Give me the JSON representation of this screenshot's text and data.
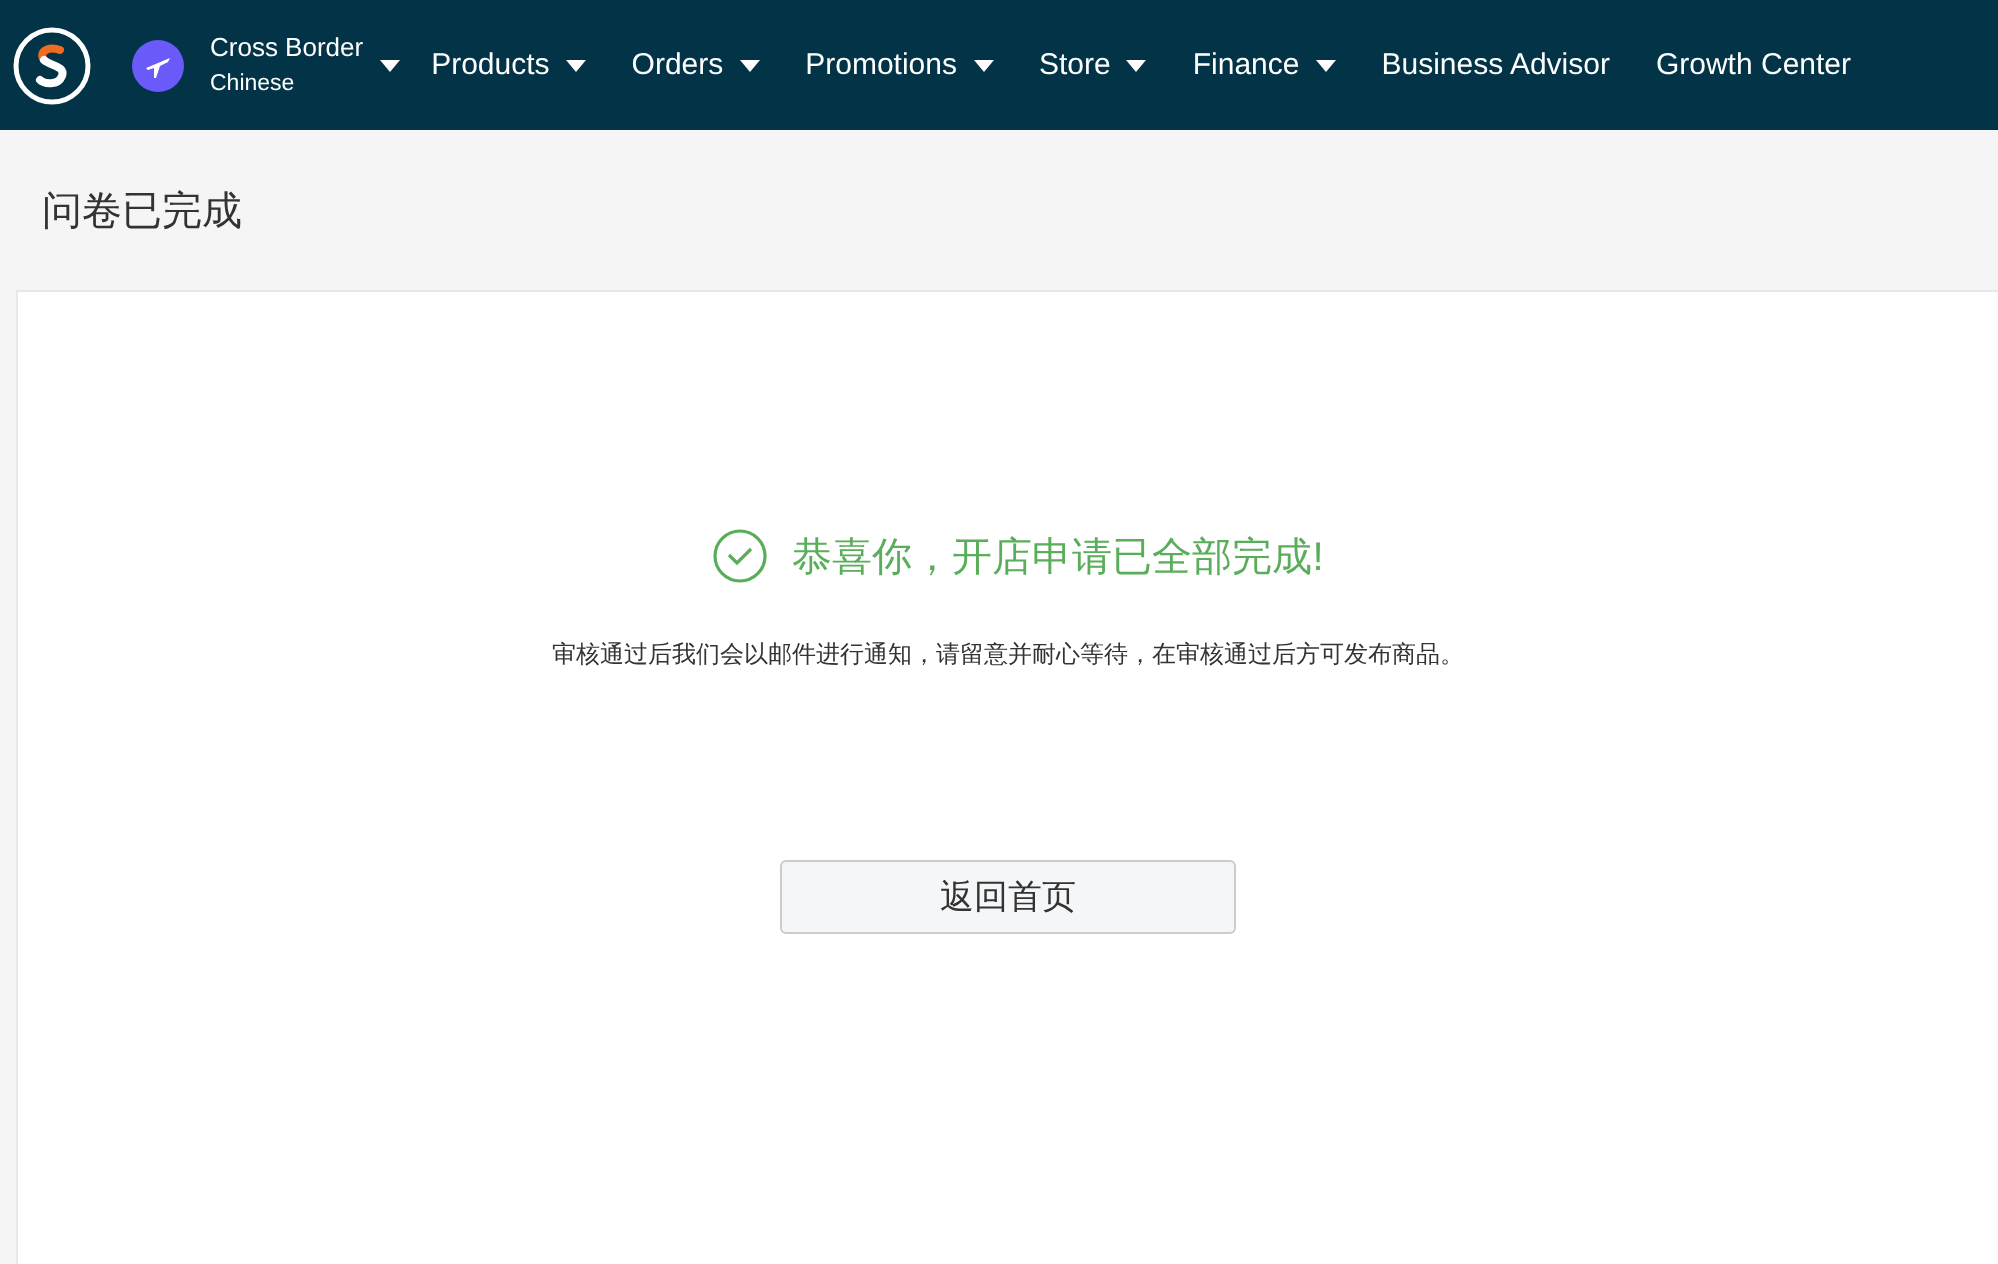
{
  "nav": {
    "account": {
      "title": "Cross Border",
      "subtitle": "Chinese"
    },
    "items": [
      {
        "label": "Products",
        "dropdown": true
      },
      {
        "label": "Orders",
        "dropdown": true
      },
      {
        "label": "Promotions",
        "dropdown": true
      },
      {
        "label": "Store",
        "dropdown": true
      },
      {
        "label": "Finance",
        "dropdown": true
      },
      {
        "label": "Business Advisor",
        "dropdown": false
      },
      {
        "label": "Growth Center",
        "dropdown": false
      }
    ]
  },
  "page_title": "问卷已完成",
  "result": {
    "title": "恭喜你，开店申请已全部完成!",
    "message": "审核通过后我们会以邮件进行通知，请留意并耐心等待，在审核通过后方可发布商品。",
    "button": "返回首页"
  }
}
